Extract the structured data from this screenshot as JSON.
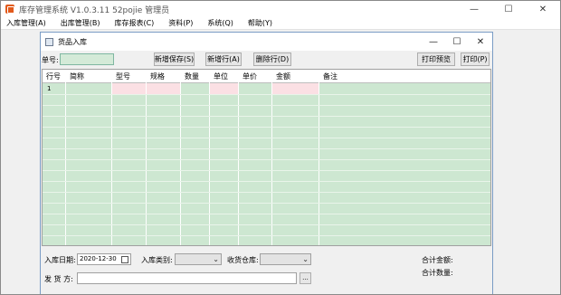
{
  "app": {
    "title": "库存管理系统 V1.0.3.11   52pojie 管理员",
    "minimize_glyph": "—",
    "maximize_glyph": "☐",
    "close_glyph": "✕",
    "icon": "app-logo-icon"
  },
  "menu": [
    {
      "label": "入库管理(A)"
    },
    {
      "label": "出库管理(B)"
    },
    {
      "label": "库存报表(C)"
    },
    {
      "label": "资料(P)"
    },
    {
      "label": "系统(Q)"
    },
    {
      "label": "帮助(Y)"
    }
  ],
  "child": {
    "title": "货品入库",
    "minimize_glyph": "—",
    "maximize_glyph": "☐",
    "close_glyph": "✕"
  },
  "toolbar": {
    "doc_no_label": "单号:",
    "doc_no_value": "",
    "add_save": "新增保存(S)",
    "add_row": "新增行(A)",
    "delete_row": "删除行(D)",
    "print_preview": "打印预览",
    "print": "打印(P)"
  },
  "grid": {
    "headers": [
      "行号",
      "简称",
      "型号",
      "规格",
      "数量",
      "单位",
      "单价",
      "金额",
      "备注"
    ],
    "rows": [
      {
        "row_no": "1"
      }
    ],
    "colors": {
      "body": "#cde7d1",
      "editable": "#fbe0e4"
    }
  },
  "footer": {
    "inbound_date_label": "入库日期:",
    "inbound_date_value": "2020-12-30",
    "inbound_type_label": "入库类别:",
    "inbound_type_value": "",
    "warehouse_label": "收货仓库:",
    "warehouse_value": "",
    "sender_label": "发 货 方:",
    "sender_value": "",
    "browse_label": "...",
    "total_amount_label": "合计金额:",
    "total_qty_label": "合计数量:"
  }
}
